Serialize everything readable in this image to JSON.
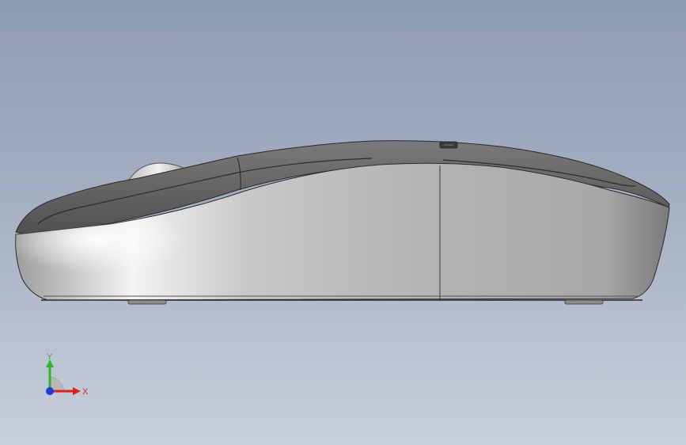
{
  "viewport": {
    "background_top": "#8e9cb1",
    "background_bottom": "#c7cfdb"
  },
  "model": {
    "view": "side",
    "body_color": "#b9b9b9",
    "top_shell_color": "#5f5f5f"
  },
  "triad": {
    "x_label": "X",
    "y_label": "Y",
    "x_color": "#e0201c",
    "y_color": "#2fb52c",
    "z_color": "#1e3cd8"
  }
}
